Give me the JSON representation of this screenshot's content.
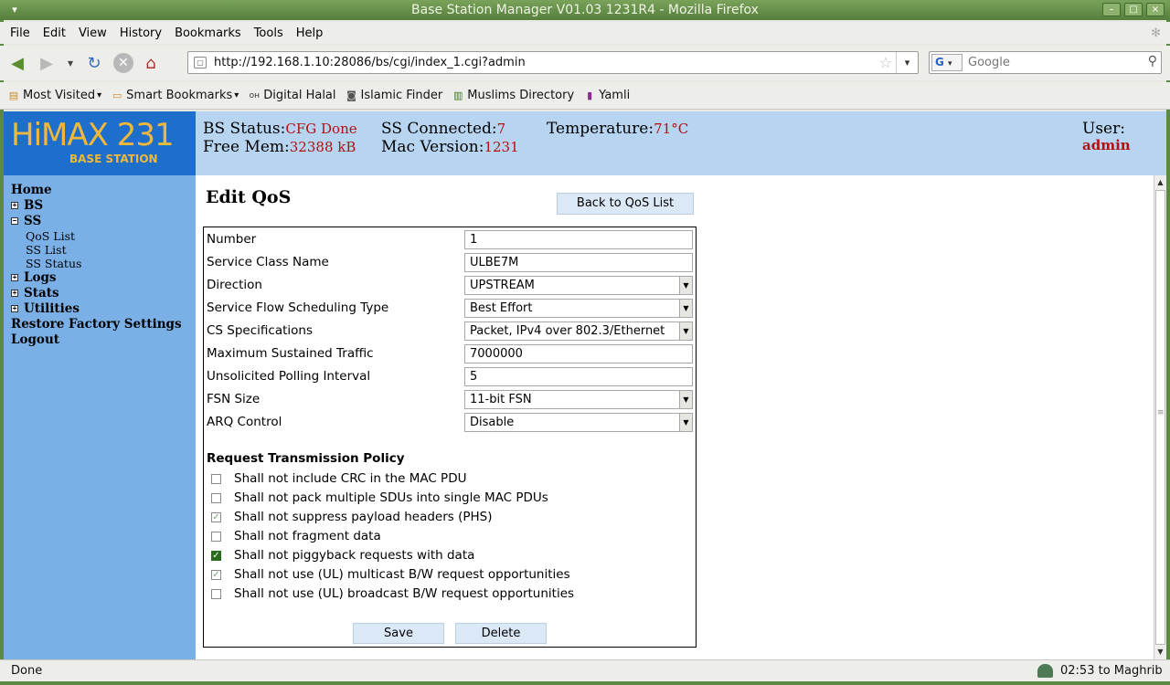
{
  "window": {
    "title": "Base Station Manager V01.03 1231R4 - Mozilla Firefox"
  },
  "menubar": {
    "items": [
      "File",
      "Edit",
      "View",
      "History",
      "Bookmarks",
      "Tools",
      "Help"
    ]
  },
  "navigation": {
    "url": "http://192.168.1.10:28086/bs/cgi/index_1.cgi?admin",
    "search_placeholder": "Google",
    "search_engine": "G"
  },
  "bookmarks": [
    "Most Visited",
    "Smart Bookmarks",
    "Digital Halal",
    "Islamic Finder",
    "Muslims Directory",
    "Yamli"
  ],
  "header": {
    "logo_text": "HiMAX 231",
    "logo_sub": "BASE STATION",
    "bs_status_label": "BS Status:",
    "bs_status_value": "CFG Done",
    "free_mem_label": "Free Mem:",
    "free_mem_value": "32388 kB",
    "ss_connected_label": "SS Connected:",
    "ss_connected_value": "7",
    "mac_version_label": "Mac Version:",
    "mac_version_value": "1231",
    "temperature_label": "Temperature:",
    "temperature_value": "71°C",
    "user_label": "User:",
    "user_value": "admin"
  },
  "sidebar": {
    "home": "Home",
    "bs": "BS",
    "ss": "SS",
    "ss_children": [
      "QoS List",
      "SS List",
      "SS Status"
    ],
    "logs": "Logs",
    "stats": "Stats",
    "utilities": "Utilities",
    "restore": "Restore Factory Settings",
    "logout": "Logout"
  },
  "form": {
    "title": "Edit QoS",
    "back_button": "Back to QoS List",
    "fields": [
      {
        "label": "Number",
        "value": "1",
        "type": "text"
      },
      {
        "label": "Service Class Name",
        "value": "ULBE7M",
        "type": "text"
      },
      {
        "label": "Direction",
        "value": "UPSTREAM",
        "type": "select"
      },
      {
        "label": "Service Flow Scheduling Type",
        "value": "Best Effort",
        "type": "select"
      },
      {
        "label": "CS Specifications",
        "value": "Packet, IPv4 over 802.3/Ethernet",
        "type": "select"
      },
      {
        "label": "Maximum Sustained Traffic",
        "value": "7000000",
        "type": "text"
      },
      {
        "label": "Unsolicited Polling Interval",
        "value": "5",
        "type": "text"
      },
      {
        "label": "FSN Size",
        "value": "11-bit FSN",
        "type": "select"
      },
      {
        "label": "ARQ Control",
        "value": "Disable",
        "type": "select"
      }
    ],
    "policy_title": "Request Transmission Policy",
    "policies": [
      {
        "label": "Shall not include CRC in the MAC PDU",
        "checked": false,
        "disabled": false
      },
      {
        "label": "Shall not pack multiple SDUs into single MAC PDUs",
        "checked": false,
        "disabled": false
      },
      {
        "label": "Shall not suppress payload headers (PHS)",
        "checked": true,
        "disabled": true
      },
      {
        "label": "Shall not fragment data",
        "checked": false,
        "disabled": false
      },
      {
        "label": "Shall not piggyback requests with data",
        "checked": true,
        "disabled": false
      },
      {
        "label": "Shall not use (UL) multicast B/W request opportunities",
        "checked": true,
        "disabled": true
      },
      {
        "label": "Shall not use (UL) broadcast B/W request opportunities",
        "checked": false,
        "disabled": false
      }
    ],
    "save_button": "Save",
    "delete_button": "Delete"
  },
  "statusbar": {
    "status": "Done",
    "prayer": "02:53 to Maghrib"
  },
  "colors": {
    "header_bg": "#b7d5f0",
    "sidebar_bg": "#7ab0e6",
    "logo_bg": "#1d6fcb",
    "value_red": "#b01010",
    "titlebar_green": "#6b9a4a"
  }
}
